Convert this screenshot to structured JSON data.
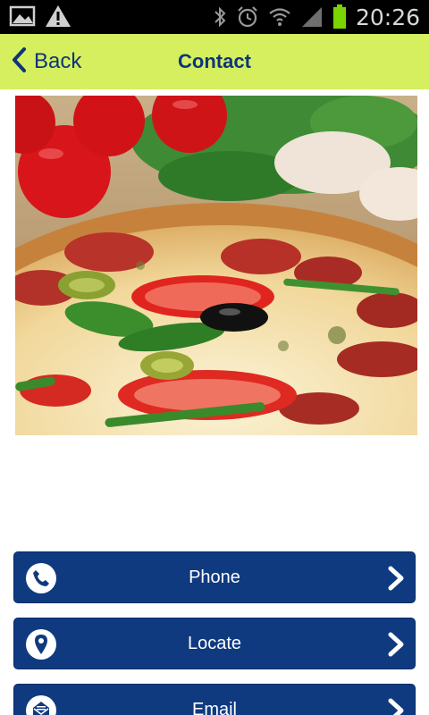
{
  "status_bar": {
    "time": "20:26",
    "icons": [
      "image-icon",
      "warning-icon",
      "bluetooth-icon",
      "alarm-icon",
      "wifi-icon",
      "signal-icon",
      "battery-icon"
    ]
  },
  "header": {
    "back_label": "Back",
    "title": "Contact"
  },
  "hero": {
    "subject": "pizza-photo"
  },
  "actions": [
    {
      "label": "Phone",
      "icon": "phone-icon"
    },
    {
      "label": "Locate",
      "icon": "location-pin-icon"
    },
    {
      "label": "Email",
      "icon": "email-icon"
    }
  ],
  "colors": {
    "header_bg": "#d6ef5e",
    "header_text": "#0e3579",
    "button_bg": "#0f3a80",
    "status_bg": "#000000"
  }
}
